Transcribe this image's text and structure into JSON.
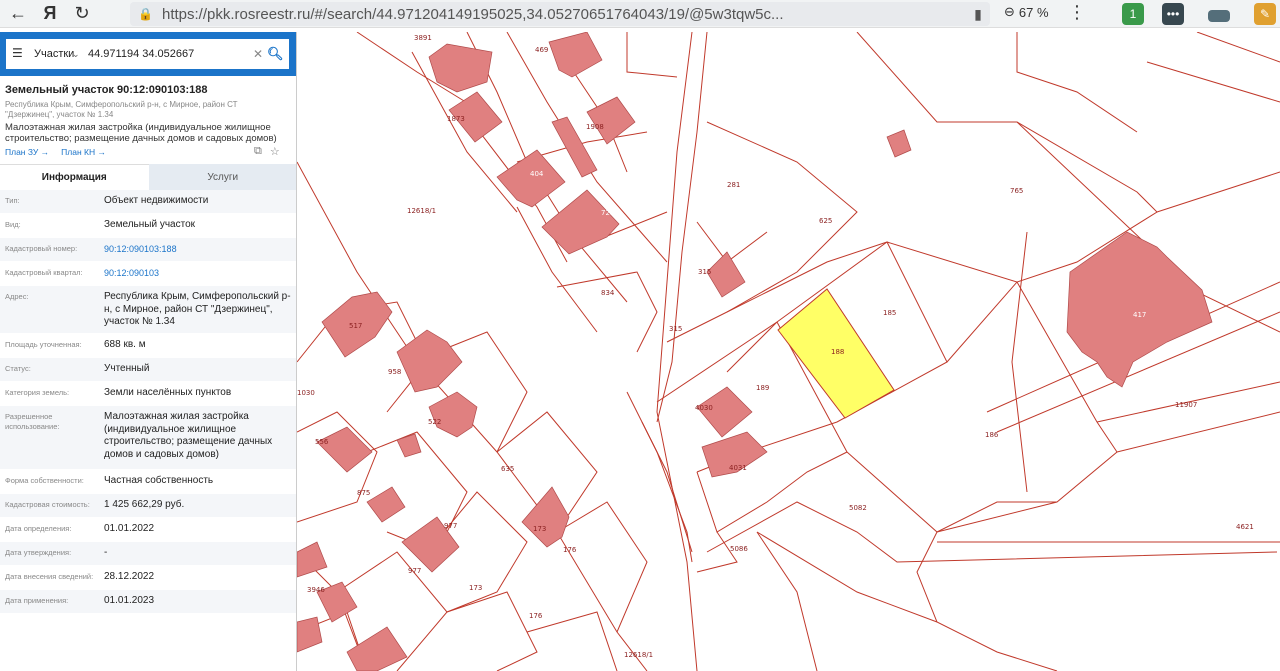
{
  "browser": {
    "url": "https://pkk.rosreestr.ru/#/search/44.971204149195025,34.05270651764043/19/@5w3tqw5c...",
    "zoom": "67 %"
  },
  "search": {
    "type": "Участки",
    "query": "44.971194 34.052667"
  },
  "parcel": {
    "title": "Земельный участок 90:12:090103:188",
    "address": "Республика Крым, Симферопольский р-н, с Мирное, район СТ \"Дзержинец\", участок № 1.34",
    "usage": "Малоэтажная жилая застройка (индивидуальное жилищное строительство; размещение дачных домов и садовых домов)",
    "plan_zu": "План ЗУ →",
    "plan_kn": "План КН →"
  },
  "tabs": {
    "info": "Информация",
    "services": "Услуги"
  },
  "info_rows": [
    {
      "label": "Тип:",
      "value": "Объект недвижимости"
    },
    {
      "label": "Вид:",
      "value": "Земельный участок"
    },
    {
      "label": "Кадастровый номер:",
      "value": "90:12:090103:188"
    },
    {
      "label": "Кадастровый квартал:",
      "value": "90:12:090103"
    },
    {
      "label": "Адрес:",
      "value": "Республика Крым, Симферопольский р-н, с Мирное, район СТ \"Дзержинец\", участок № 1.34"
    },
    {
      "label": "Площадь уточненная:",
      "value": "688 кв. м"
    },
    {
      "label": "Статус:",
      "value": "Учтенный"
    },
    {
      "label": "Категория земель:",
      "value": "Земли населённых пунктов"
    },
    {
      "label": "Разрешенное использование:",
      "value": "Малоэтажная жилая застройка (индивидуальное жилищное строительство; размещение дачных домов и садовых домов)"
    },
    {
      "label": "Форма собственности:",
      "value": "Частная собственность"
    },
    {
      "label": "Кадастровая стоимость:",
      "value": "1 425 662,29 руб."
    },
    {
      "label": "Дата определения:",
      "value": "01.01.2022"
    },
    {
      "label": "Дата утверждения:",
      "value": "-"
    },
    {
      "label": "Дата внесения сведений:",
      "value": "28.12.2022"
    },
    {
      "label": "Дата применения:",
      "value": "01.01.2023"
    }
  ],
  "map": {
    "labels": {
      "l3891": "3891",
      "l469": "469",
      "l12618a": "12618/1",
      "l12618b": "12618/1",
      "l1873": "1873",
      "l1908": "1908",
      "l404": "404",
      "l721": "721",
      "l281": "281",
      "l625": "625",
      "l765": "765",
      "l315a": "315",
      "l315b": "315",
      "l834": "834",
      "l185": "185",
      "l188": "188",
      "l189": "189",
      "l4030": "4030",
      "l4031": "4031",
      "l186": "186",
      "l11907": "11907",
      "l5082": "5082",
      "l5086": "5086",
      "l4621": "4621",
      "l517": "517",
      "l958": "958",
      "l522": "522",
      "l1030": "1030",
      "l556": "556",
      "l875": "875",
      "l635": "635",
      "l977a": "977",
      "l977b": "977",
      "l173a": "173",
      "l173b": "173",
      "l176a": "176",
      "l176b": "176",
      "l3946": "3946",
      "l417": "417"
    }
  }
}
